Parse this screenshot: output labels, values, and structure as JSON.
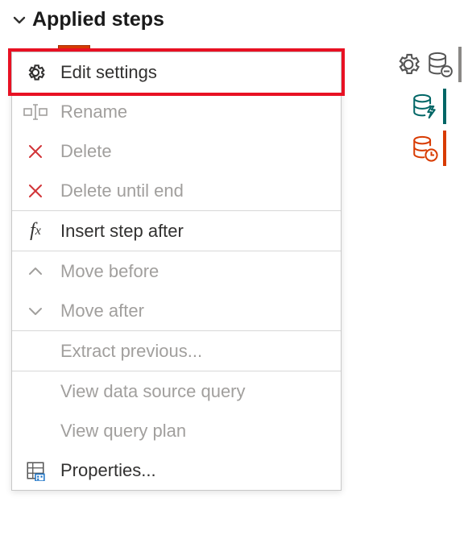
{
  "header": {
    "title": "Applied steps"
  },
  "contextMenu": {
    "edit_settings": "Edit settings",
    "rename": "Rename",
    "delete": "Delete",
    "delete_until_end": "Delete until end",
    "insert_step_after": "Insert step after",
    "move_before": "Move before",
    "move_after": "Move after",
    "extract_previous": "Extract previous...",
    "view_data_source_query": "View data source query",
    "view_query_plan": "View query plan",
    "properties": "Properties..."
  },
  "icons": {
    "chevron_down": "chevron-down-icon",
    "gear": "gear-icon",
    "rename": "rename-icon",
    "x_red": "x-icon",
    "fx": "fx-icon",
    "chevron_up_small": "chevron-up-icon",
    "chevron_down_small": "chevron-down-icon",
    "properties_grid": "properties-icon",
    "db_minus": "database-minus-icon",
    "db_lightning": "database-lightning-icon",
    "db_clock": "database-clock-icon"
  },
  "colors": {
    "highlight": "#e81123",
    "orange": "#d83b01",
    "teal": "#006666",
    "grey_border": "#8a8886"
  }
}
